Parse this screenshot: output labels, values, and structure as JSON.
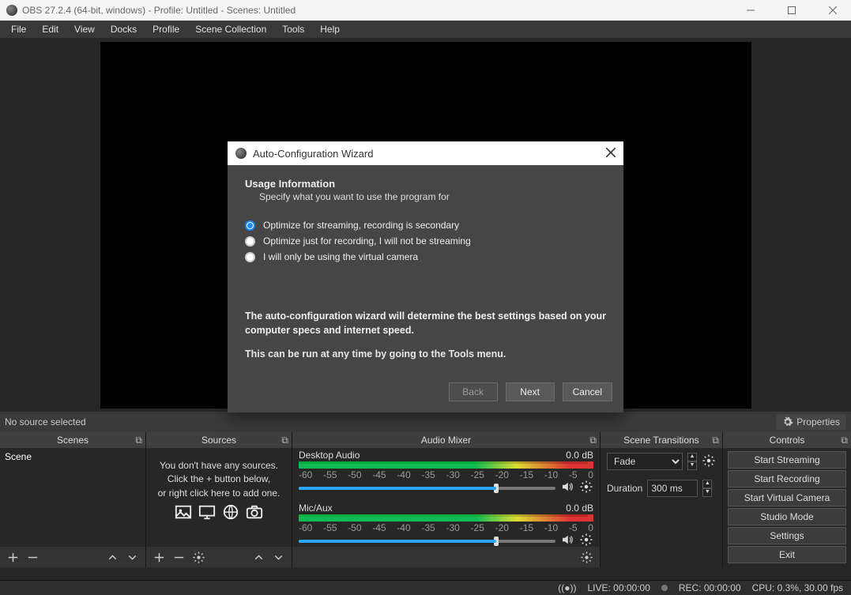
{
  "title": "OBS 27.2.4 (64-bit, windows) - Profile: Untitled - Scenes: Untitled",
  "menu": {
    "file": "File",
    "edit": "Edit",
    "view": "View",
    "docks": "Docks",
    "profile": "Profile",
    "scenecol": "Scene Collection",
    "tools": "Tools",
    "help": "Help"
  },
  "sourcebar": {
    "nosrc": "No source selected",
    "properties": "Properties"
  },
  "docks": {
    "scenes": {
      "title": "Scenes",
      "item": "Scene"
    },
    "sources": {
      "title": "Sources",
      "empty1": "You don't have any sources.",
      "empty2": "Click the + button below,",
      "empty3": "or right click here to add one."
    },
    "mixer": {
      "title": "Audio Mixer",
      "ch1": "Desktop Audio",
      "ch2": "Mic/Aux",
      "db": "0.0 dB",
      "ticks": [
        "-60",
        "-55",
        "-50",
        "-45",
        "-40",
        "-35",
        "-30",
        "-25",
        "-20",
        "-15",
        "-10",
        "-5",
        "0"
      ]
    },
    "trans": {
      "title": "Scene Transitions",
      "mode": "Fade",
      "durlabel": "Duration",
      "dur": "300 ms"
    },
    "controls": {
      "title": "Controls",
      "b1": "Start Streaming",
      "b2": "Start Recording",
      "b3": "Start Virtual Camera",
      "b4": "Studio Mode",
      "b5": "Settings",
      "b6": "Exit"
    }
  },
  "status": {
    "live": "LIVE: 00:00:00",
    "rec": "REC: 00:00:00",
    "cpu": "CPU: 0.3%, 30.00 fps"
  },
  "modal": {
    "title": "Auto-Configuration Wizard",
    "heading": "Usage Information",
    "sub": "Specify what you want to use the program for",
    "opt1": "Optimize for streaming, recording is secondary",
    "opt2": "Optimize just for recording, I will not be streaming",
    "opt3": "I will only be using the virtual camera",
    "note1": "The auto-configuration wizard will determine the best settings based on your computer specs and internet speed.",
    "note2": "This can be run at any time by going to the Tools menu.",
    "back": "Back",
    "next": "Next",
    "cancel": "Cancel"
  }
}
